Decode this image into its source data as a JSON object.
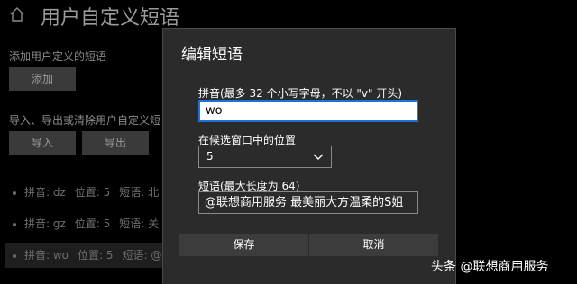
{
  "background": {
    "page_title": "用户自定义短语",
    "add_section_label": "添加用户定义的短语",
    "add_button": "添加",
    "io_section_label": "导入、导出或清除用户自定义短",
    "import_button": "导入",
    "export_button": "导出",
    "phrases": [
      {
        "pinyin_label": "拼音: dz",
        "position_label": "位置: 5",
        "phrase_label": "短语: 北"
      },
      {
        "pinyin_label": "拼音: gz",
        "position_label": "位置: 5",
        "phrase_label": "短语: 关"
      },
      {
        "pinyin_label": "拼音: wo",
        "position_label": "位置: 5",
        "phrase_label": "短语: @"
      }
    ]
  },
  "dialog": {
    "title": "编辑短语",
    "pinyin_label": "拼音(最多 32 个小写字母，不以 \"v\" 开头)",
    "pinyin_value": "wo",
    "position_label": "在候选窗口中的位置",
    "position_value": "5",
    "phrase_label": "短语(最大长度为 64)",
    "phrase_value": "@联想商用服务 最美丽大方温柔的S姐",
    "save_button": "保存",
    "cancel_button": "取消"
  },
  "watermark": "头条 @联想商用服务",
  "colors": {
    "background": "#000000",
    "dialog": "#2b2b2b",
    "focus_border": "#1a73d6",
    "button": "#3c3c3c"
  },
  "icons": [
    "home-icon",
    "chevron-down-icon"
  ]
}
